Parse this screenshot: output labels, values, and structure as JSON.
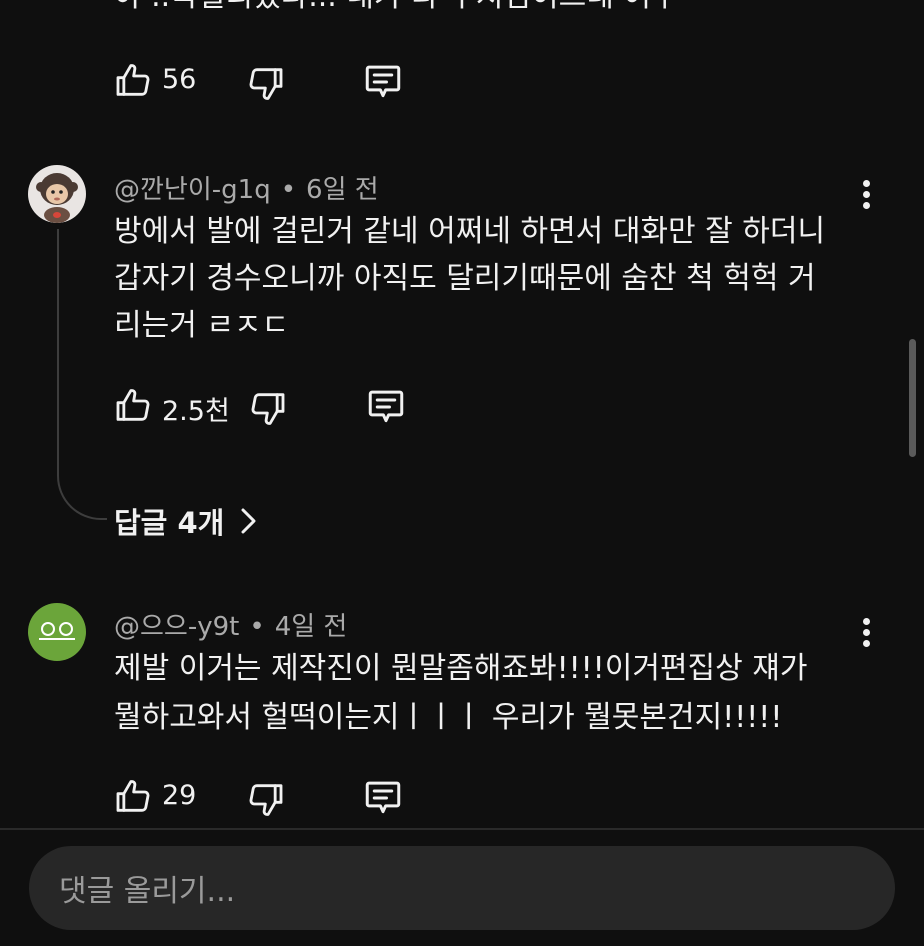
{
  "comments": [
    {
      "text_partial": "아 ..꼭빌리겠다... 내가 다 우지심이드네 어우",
      "likes": "56"
    },
    {
      "author": "@깐난이-g1q",
      "time": "6일 전",
      "lines": [
        "방에서 발에 걸린거 같네 어쩌네 하면서 대화만 잘 하더니",
        "갑자기 경수오니까 아직도 달리기때문에 숨찬 척 헉헉 거",
        "리는거 ㄹㅈㄷ"
      ],
      "likes": "2.5천",
      "replies_label": "답글 4개"
    },
    {
      "author": "@으으-y9t",
      "time": "4일 전",
      "avatar_text": "으으",
      "lines": [
        "제발 이거는 제작진이 뭔말좀해죠봐!!!!이거편집상 쟤가",
        "뭘하고와서 헐떡이는지ㅣㅣㅣ 우리가 뭘못본건지!!!!!"
      ],
      "likes": "29"
    }
  ],
  "input": {
    "placeholder": "댓글 올리기..."
  },
  "colors": {
    "background": "#0f0f0f",
    "text": "#f1f1f1",
    "meta": "#aaaaaa",
    "avatar_green": "#6ba53a",
    "input_bg": "#272727"
  },
  "icons": {
    "like": "thumbs-up-icon",
    "dislike": "thumbs-down-icon",
    "reply": "comment-icon",
    "more": "more-vertical-icon",
    "chevron": "chevron-right-icon"
  }
}
